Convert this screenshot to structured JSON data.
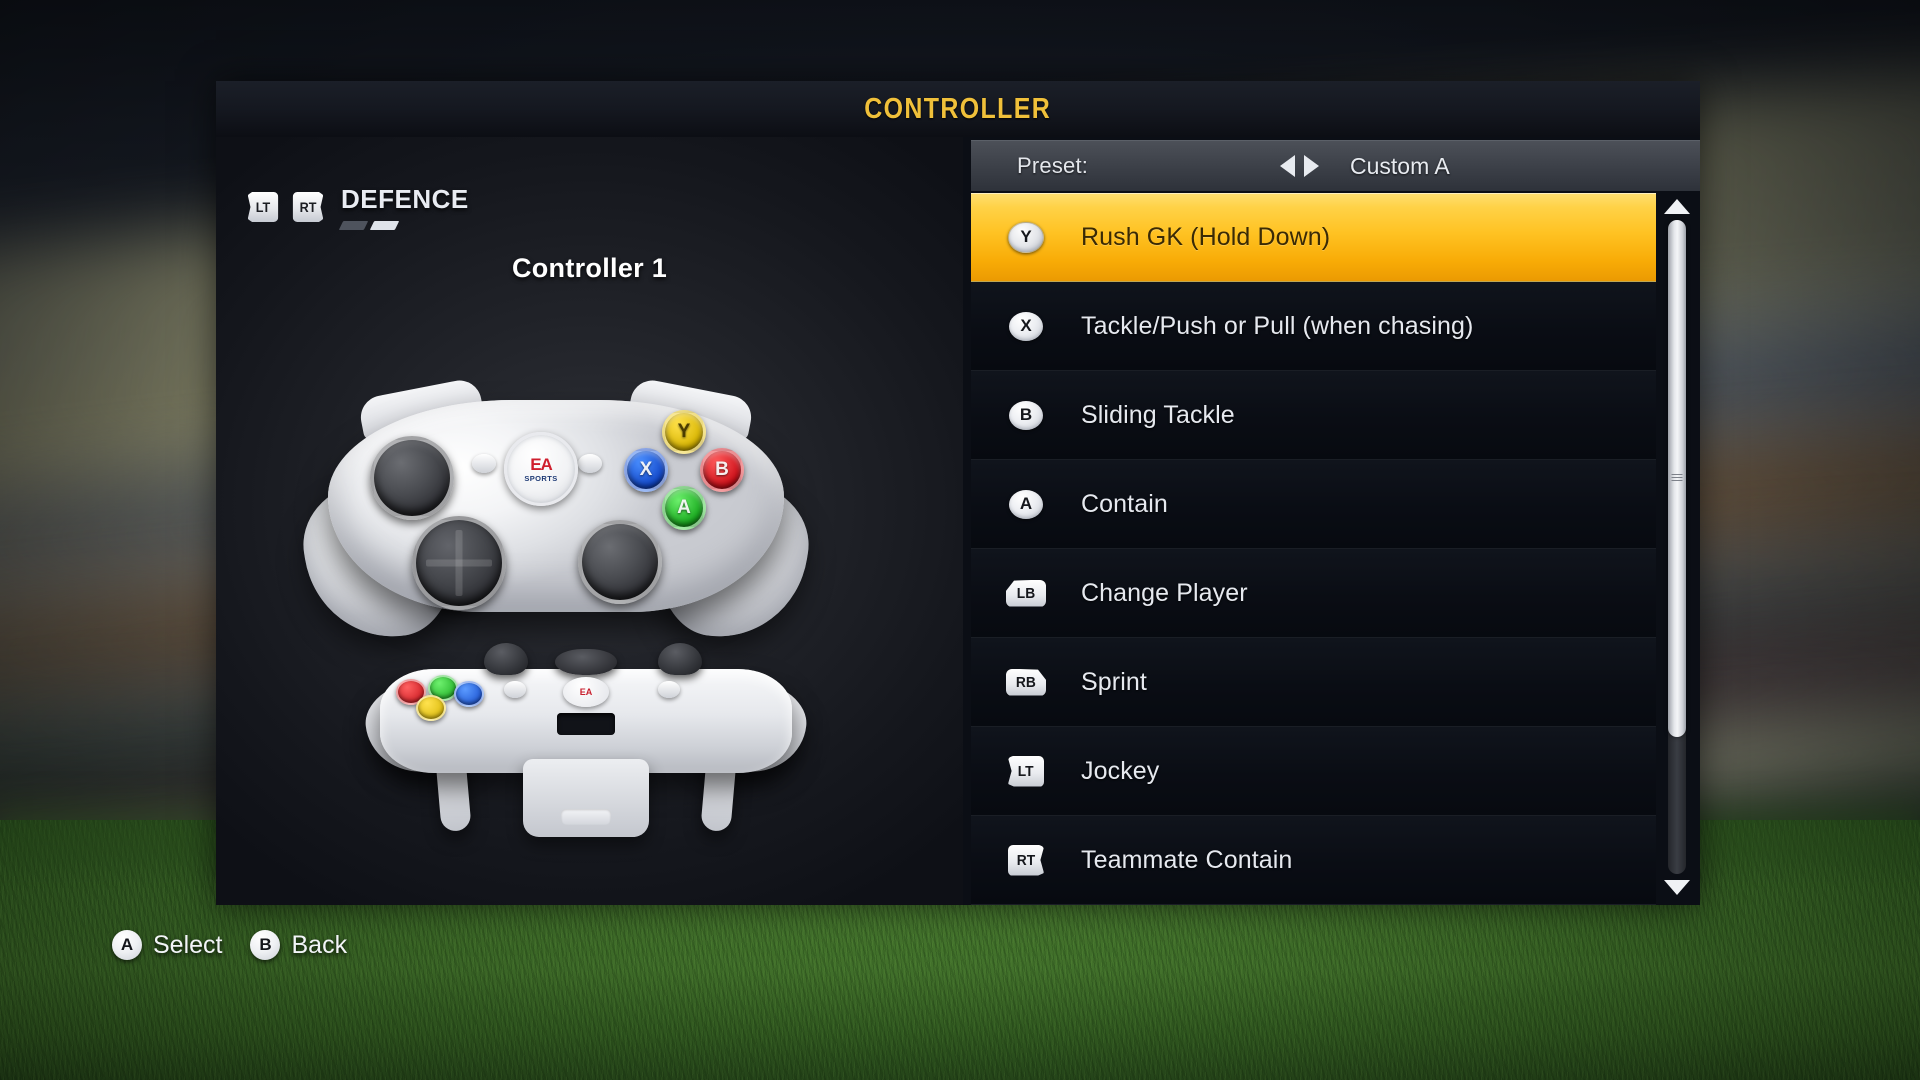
{
  "header": {
    "title": "CONTROLLER"
  },
  "left": {
    "trigger_left_label": "LT",
    "trigger_right_label": "RT",
    "category": "DEFENCE",
    "controller_label": "Controller 1",
    "pager": {
      "total": 2,
      "active_index": 1
    },
    "guide_logo_top": "EA",
    "guide_logo_bottom": "SPORTS",
    "face_y": "Y",
    "face_x": "X",
    "face_b": "B",
    "face_a": "A"
  },
  "preset": {
    "label": "Preset:",
    "value": "Custom A",
    "prev_icon": "triangle-left-icon",
    "next_icon": "triangle-right-icon"
  },
  "bindings": [
    {
      "button": "Y",
      "shape": "face",
      "action": "Rush GK (Hold Down)",
      "selected": true
    },
    {
      "button": "X",
      "shape": "face",
      "action": "Tackle/Push or Pull (when chasing)",
      "selected": false
    },
    {
      "button": "B",
      "shape": "face",
      "action": "Sliding Tackle",
      "selected": false
    },
    {
      "button": "A",
      "shape": "face",
      "action": "Contain",
      "selected": false
    },
    {
      "button": "LB",
      "shape": "bumper",
      "action": "Change Player",
      "selected": false
    },
    {
      "button": "RB",
      "shape": "bumper",
      "action": "Sprint",
      "selected": false
    },
    {
      "button": "LT",
      "shape": "trigger",
      "action": "Jockey",
      "selected": false
    },
    {
      "button": "RT",
      "shape": "trigger",
      "action": "Teammate Contain",
      "selected": false
    }
  ],
  "scrollbar": {
    "thumb_percent": 79,
    "position_percent": 0,
    "up_icon": "scroll-up-arrow-icon",
    "down_icon": "scroll-down-arrow-icon"
  },
  "footer": [
    {
      "button": "A",
      "label": "Select"
    },
    {
      "button": "B",
      "label": "Back"
    }
  ],
  "colors": {
    "accent": "#f0c03a",
    "highlight_top": "#ffe071",
    "highlight_bottom": "#eb9a02",
    "panel_bg": "#0d1017",
    "list_bg": "#0b0e15",
    "text": "#e6e9ef"
  }
}
